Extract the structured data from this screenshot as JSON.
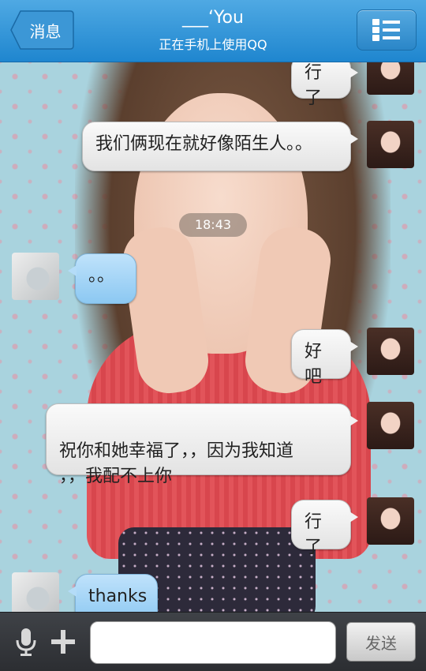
{
  "header": {
    "back_label": "消息",
    "title": "___‘You",
    "subtitle": "正在手机上使用QQ",
    "menu_icon": "list-menu-icon"
  },
  "messages": [
    {
      "side": "out",
      "text": "行了"
    },
    {
      "side": "out",
      "text": "我们俩现在就好像陌生人。。"
    },
    {
      "type": "timestamp",
      "text": "18:43"
    },
    {
      "side": "in",
      "text": "。。"
    },
    {
      "side": "out",
      "text": "好吧"
    },
    {
      "side": "out",
      "text": "祝你和她幸福了，，因为我知道\n，，我配不上你"
    },
    {
      "side": "out",
      "text": "行了"
    },
    {
      "side": "in",
      "text": "thanks"
    }
  ],
  "bottom": {
    "mic_icon": "microphone-icon",
    "plus_icon": "plus-icon",
    "input_value": "",
    "send_label": "发送"
  },
  "colors": {
    "header_blue": "#2a8fd4",
    "incoming_bubble": "#a9d7f7",
    "outgoing_bubble": "#eeeeee",
    "bottom_bar": "#35383c"
  }
}
